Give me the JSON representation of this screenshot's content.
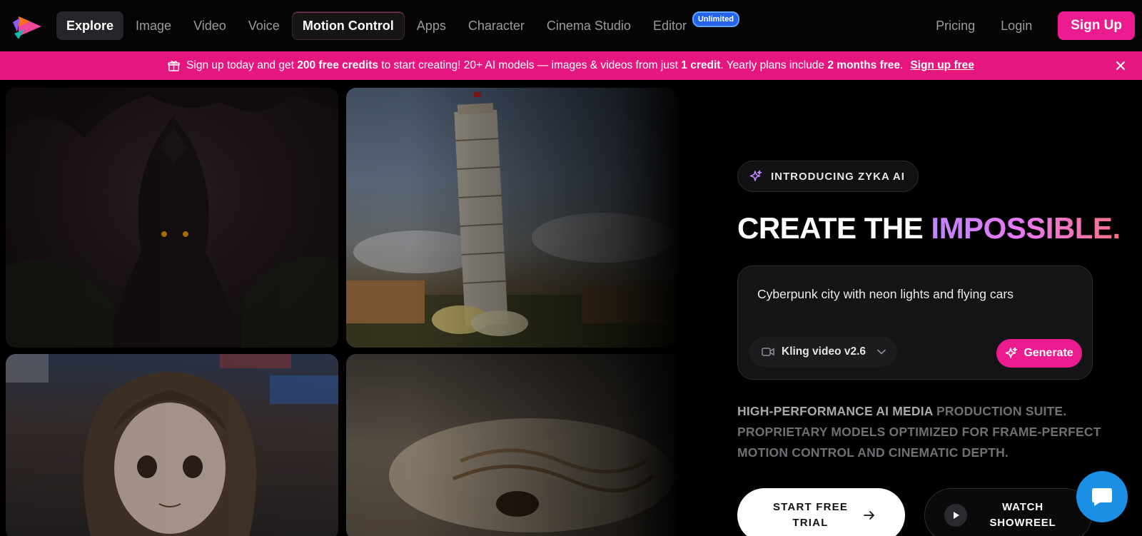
{
  "nav": {
    "items": [
      {
        "label": "Explore"
      },
      {
        "label": "Image"
      },
      {
        "label": "Video"
      },
      {
        "label": "Voice"
      },
      {
        "label": "Motion Control"
      },
      {
        "label": "Apps"
      },
      {
        "label": "Character"
      },
      {
        "label": "Cinema Studio"
      },
      {
        "label": "Editor",
        "badge": "Unlimited"
      }
    ],
    "active": "Explore",
    "pricing": "Pricing",
    "login": "Login",
    "signup": "Sign Up"
  },
  "banner": {
    "text_1": "Sign up today and get",
    "bold_1": "200 free credits",
    "text_2": "to start creating! 20+ AI models — images & videos from just",
    "bold_2": "1 credit",
    "text_3": ". Yearly plans include",
    "bold_3": "2 months free",
    "text_4": ".",
    "link": "Sign up free"
  },
  "hero": {
    "intro": "INTRODUCING ZYKA AI",
    "title_plain": "CREATE THE",
    "title_gradient": "IMPOSSIBLE.",
    "prompt": "Cyberpunk city with neon lights and flying cars",
    "model": "Kling video v2.6",
    "generate": "Generate",
    "subtitle_bright": "HIGH-PERFORMANCE AI MEDIA",
    "subtitle_rest": "PRODUCTION SUITE. PROPRIETARY MODELS OPTIMIZED FOR FRAME-PERFECT MOTION CONTROL AND CINEMATIC DEPTH.",
    "trial_button": "START FREE TRIAL",
    "showreel_button": "WATCH SHOWREEL"
  },
  "colors": {
    "accent": "#ec1b8f",
    "banner": "#e5177f",
    "badge": "#2563eb",
    "chat": "#1a8fe3"
  },
  "icons": [
    "logo-icon",
    "gift-icon",
    "close-icon",
    "sparkle-icon",
    "camera-icon",
    "chevron-down-icon",
    "arrow-right-icon",
    "play-icon",
    "chat-icon"
  ]
}
